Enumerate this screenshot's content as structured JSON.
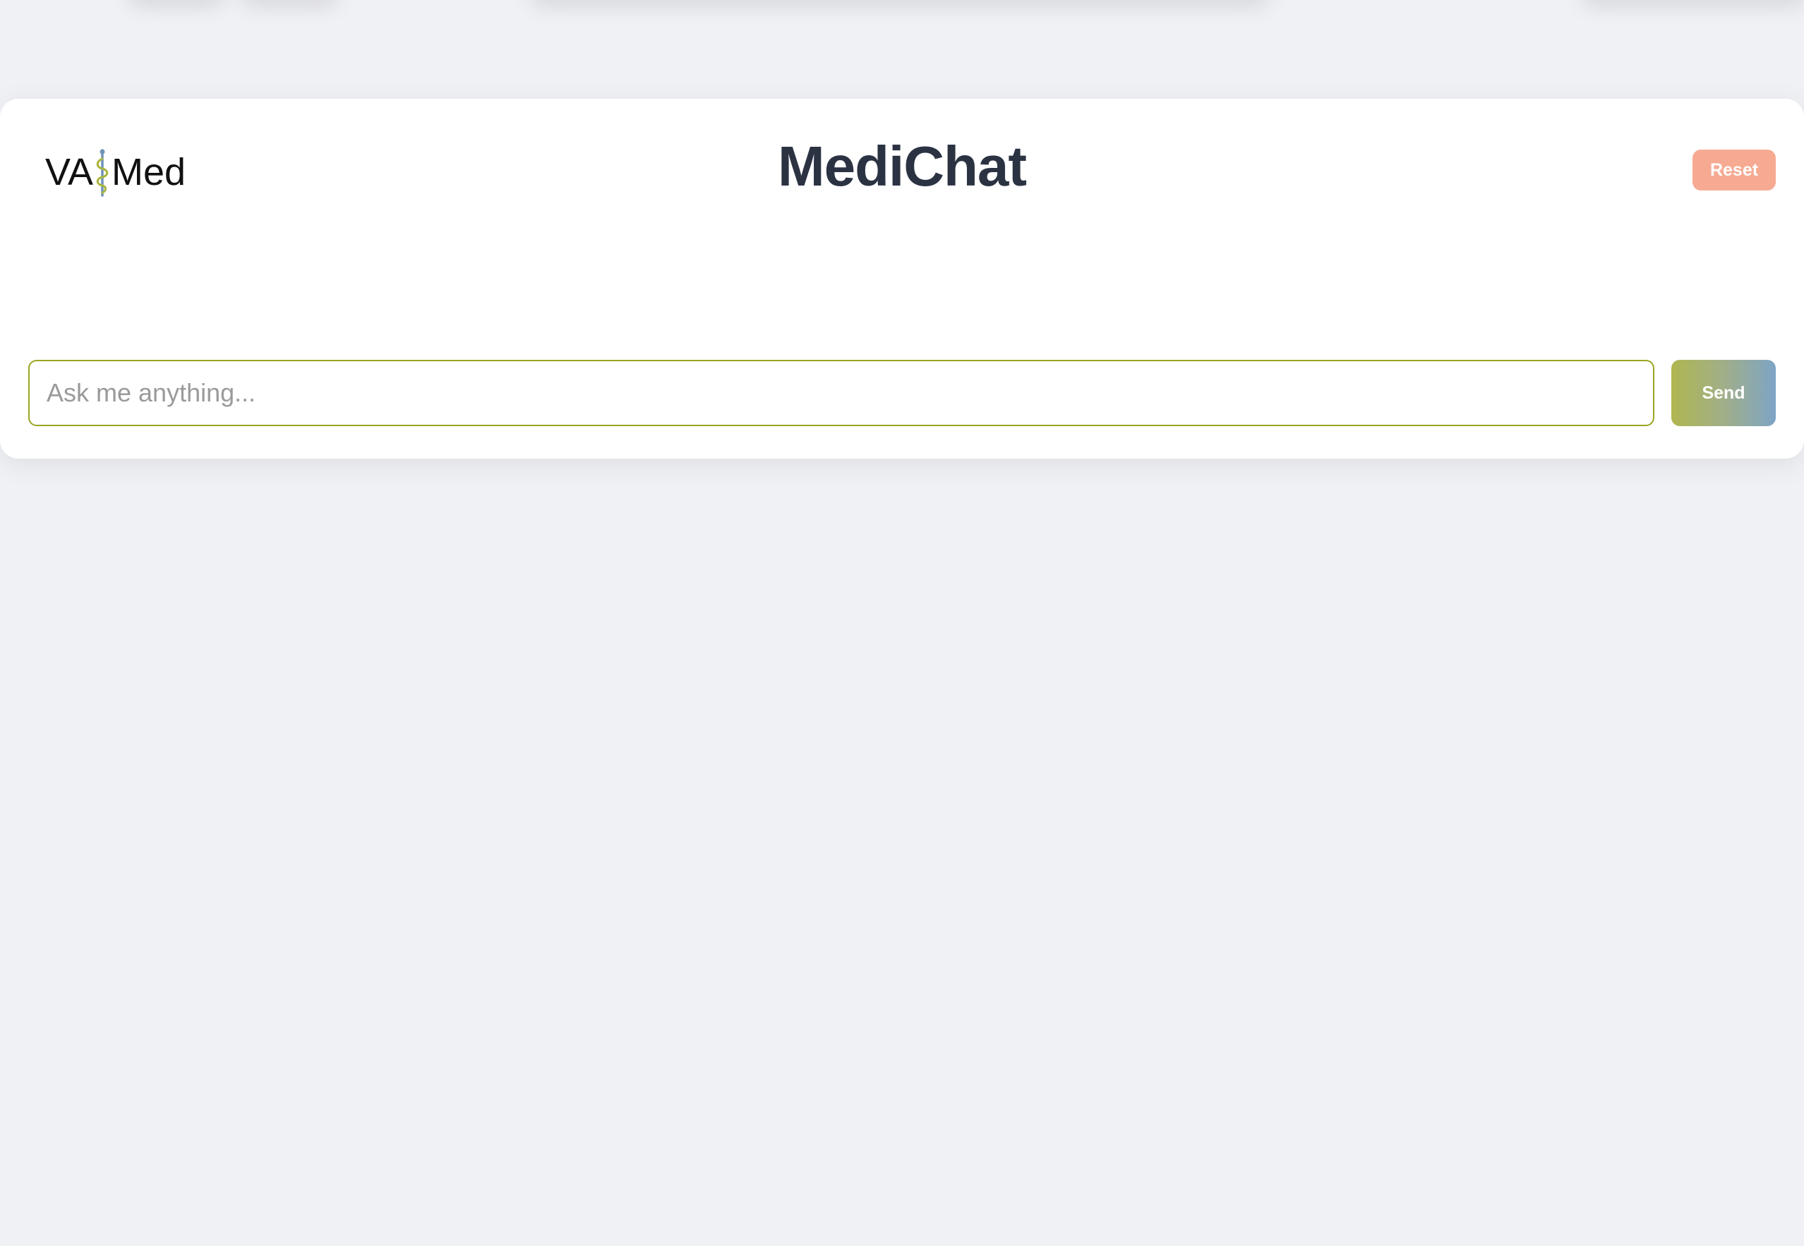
{
  "header": {
    "logo": {
      "text_left": "VA",
      "text_right": "Med",
      "icon": "caduceus-icon",
      "icon_colors": {
        "staff": "#6f93b8",
        "snake": "#a8b53c"
      }
    },
    "title": "MediChat",
    "reset_label": "Reset"
  },
  "composer": {
    "input_placeholder": "Ask me anything...",
    "input_value": "",
    "send_label": "Send"
  },
  "colors": {
    "background": "#f0f1f5",
    "card": "#ffffff",
    "title": "#2b3343",
    "reset_button": "#f6aa92",
    "input_border": "#9aa520",
    "send_gradient_start": "#b0b650",
    "send_gradient_end": "#7ea4c6"
  }
}
